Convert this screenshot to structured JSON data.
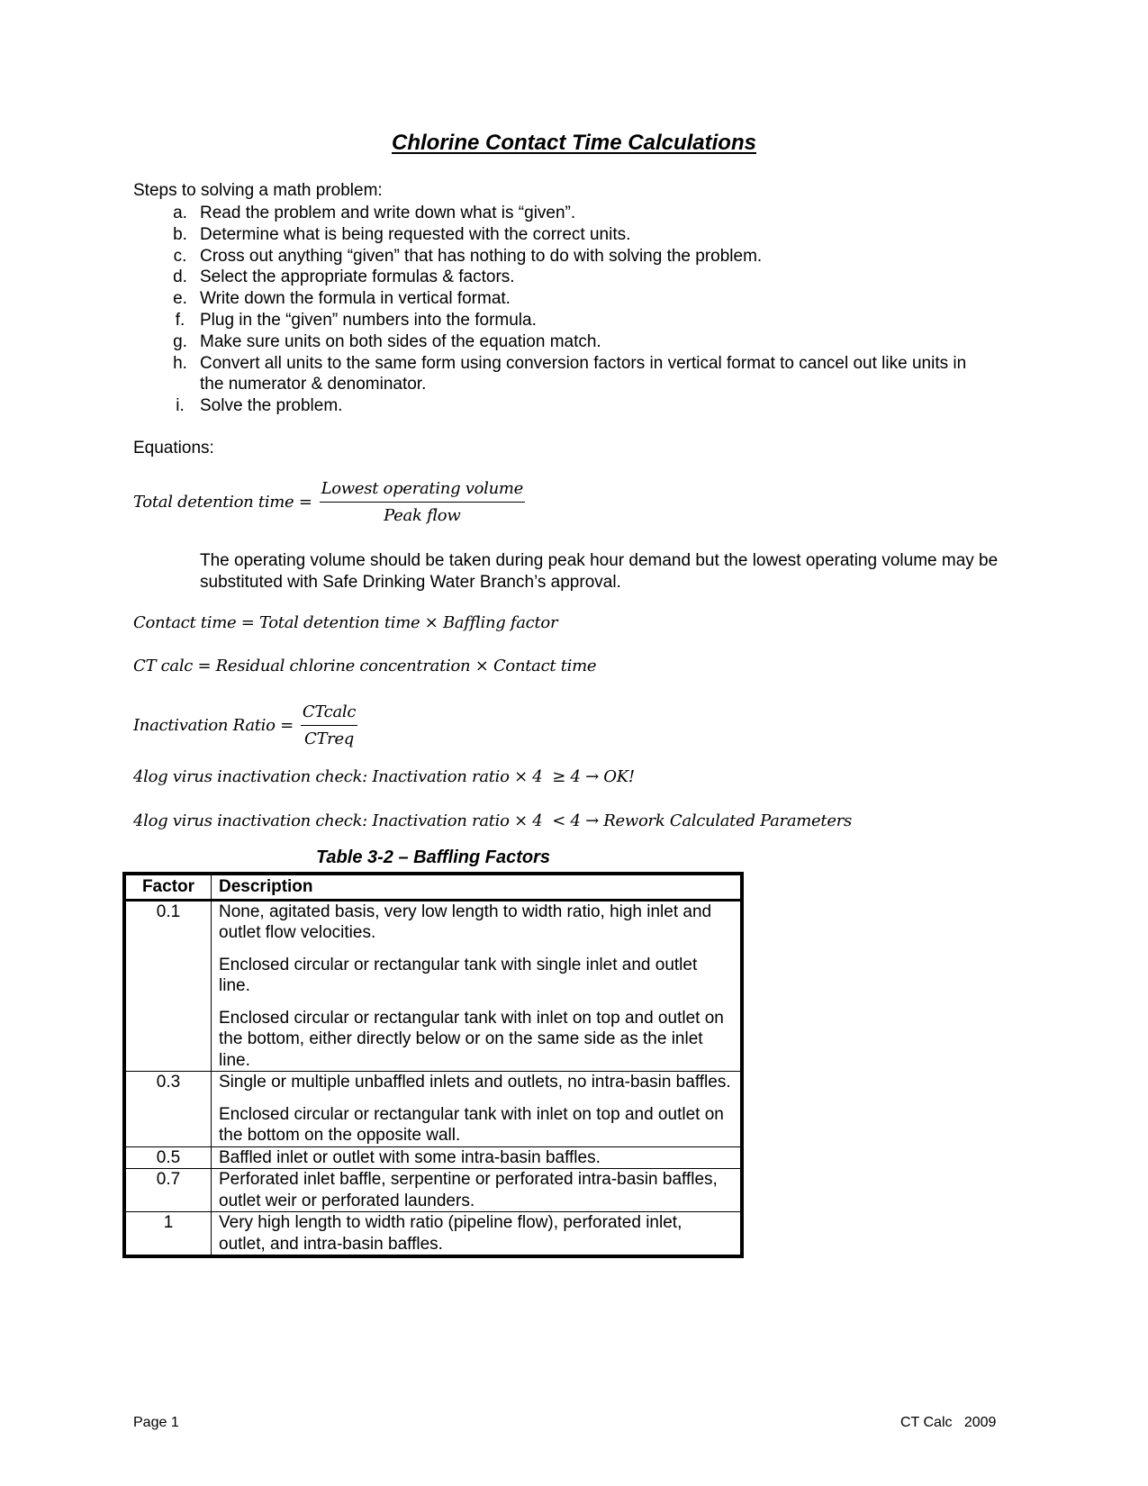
{
  "title": "Chlorine Contact Time Calculations",
  "steps": {
    "heading": "Steps to solving a math problem:",
    "items": [
      {
        "label": "a.",
        "text": "Read the problem and write down what is “given”."
      },
      {
        "label": "b.",
        "text": "Determine what is being requested with the correct units."
      },
      {
        "label": "c.",
        "text": "Cross out anything “given” that has nothing to do with solving the problem."
      },
      {
        "label": "d.",
        "text": "Select the appropriate formulas & factors."
      },
      {
        "label": "e.",
        "text": "Write down the formula in vertical format."
      },
      {
        "label": "f.",
        "text": "Plug in the “given” numbers into the formula."
      },
      {
        "label": "g.",
        "text": "Make sure units on both sides of the equation match."
      },
      {
        "label": "h.",
        "text": "Convert all units to the same form using conversion factors in vertical format to cancel out like units in the numerator & denominator."
      },
      {
        "label": "i.",
        "text": "Solve the problem."
      }
    ]
  },
  "equations": {
    "heading": "Equations:",
    "detention": {
      "lhs": "Total detention time =",
      "numerator": "Lowest operating volume",
      "denominator": "Peak flow"
    },
    "note": "The operating volume should be taken during peak hour demand but the lowest operating volume may be substituted with Safe Drinking Water Branch’s approval.",
    "contact_time": "Contact time = Total detention time × Baffling factor",
    "ct_calc": "CT calc = Residual chlorine concentration × Contact time",
    "inactivation": {
      "lhs": "Inactivation Ratio =",
      "numerator": "CTcalc",
      "denominator": "CTreq"
    },
    "check_ok": "4log virus inactivation check: Inactivation ratio × 4  ≥ 4 → OK!",
    "check_rework": "4log virus inactivation check: Inactivation ratio × 4  < 4 → Rework Calculated Parameters"
  },
  "table": {
    "caption": "Table 3-2 – Baffling Factors",
    "headers": [
      "Factor",
      "Description"
    ],
    "rows": [
      {
        "factor": "0.1",
        "descriptions": [
          "None, agitated basis, very low length to width ratio, high inlet and outlet flow velocities.",
          "Enclosed circular or rectangular tank with single inlet and outlet line.",
          "Enclosed circular or rectangular tank with inlet on top and outlet on the bottom, either directly below or on the same side as the inlet line."
        ]
      },
      {
        "factor": "0.3",
        "descriptions": [
          "Single or multiple unbaffled inlets and outlets, no intra-basin baffles.",
          "Enclosed circular or rectangular tank with inlet on top and outlet on the bottom on the opposite wall."
        ]
      },
      {
        "factor": "0.5",
        "descriptions": [
          "Baffled inlet or outlet with some intra-basin baffles."
        ]
      },
      {
        "factor": "0.7",
        "descriptions": [
          "Perforated inlet baffle, serpentine or perforated intra-basin baffles, outlet weir or perforated launders."
        ]
      },
      {
        "factor": "1",
        "descriptions": [
          "Very high length to width ratio (pipeline flow), perforated inlet, outlet, and intra-basin baffles."
        ]
      }
    ]
  },
  "footer": {
    "left": "Page 1",
    "right": "CT Calc   2009"
  }
}
